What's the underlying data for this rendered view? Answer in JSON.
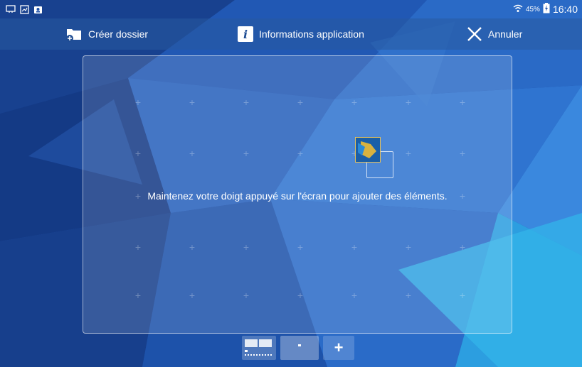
{
  "status_bar": {
    "left_icons": [
      "cast-icon",
      "screenshot-icon",
      "notification-icon"
    ],
    "wifi_icon": "wifi-icon",
    "battery_percent": "45%",
    "battery_icon": "battery-charging-icon",
    "time": "16:40"
  },
  "action_bar": {
    "create_folder": {
      "label": "Créer dossier",
      "icon": "folder-add-icon"
    },
    "app_info": {
      "label": "Informations application",
      "icon": "info-icon"
    },
    "cancel": {
      "label": "Annuler",
      "icon": "close-icon"
    }
  },
  "edit_panel": {
    "hint": "Maintenez votre doigt appuyé sur l'écran pour ajouter des éléments.",
    "grid_marker": "+",
    "dragged_item_icon": "widget-thumbnail-icon"
  },
  "page_indicator": {
    "pages": [
      "page-thumbnail-1",
      "page-thumbnail-2"
    ],
    "add_label": "+",
    "active_page": 2
  },
  "colors": {
    "wallpaper_dark": "#163a86",
    "wallpaper_mid": "#1f5fc0",
    "wallpaper_light": "#3a8fe0",
    "accent_cyan": "#2cb0e8"
  }
}
